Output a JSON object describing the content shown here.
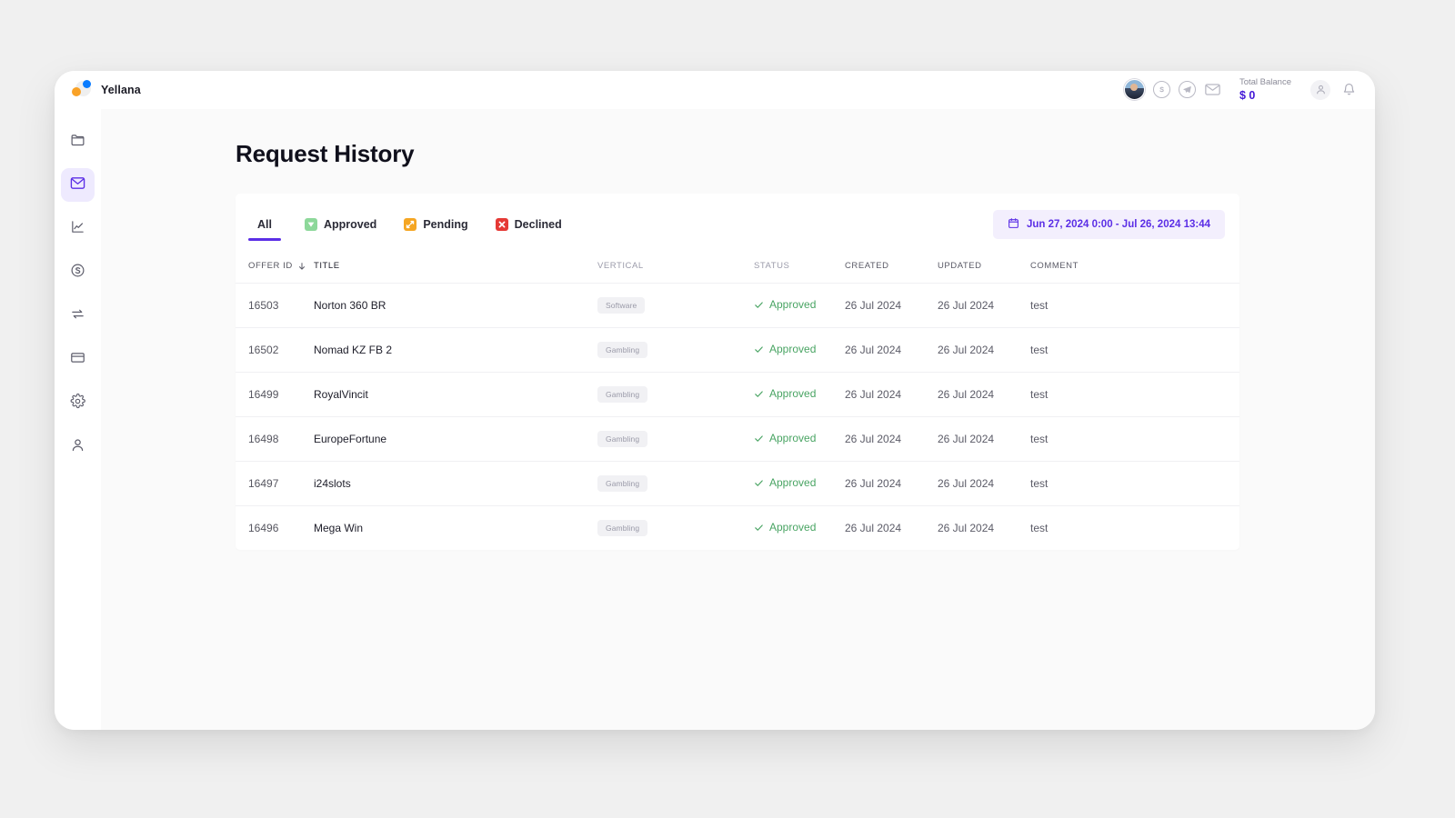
{
  "brand": {
    "name": "Yellana"
  },
  "topbar": {
    "avatar_name": "user-avatar",
    "icons": [
      "skype-icon",
      "telegram-icon",
      "mail-icon"
    ],
    "balance_label": "Total Balance",
    "balance_value": "$ 0",
    "account_icon": "user-circle-icon",
    "notification_icon": "bell-icon"
  },
  "sidebar": {
    "items": [
      {
        "name": "offers",
        "icon": "folder-icon",
        "active": false
      },
      {
        "name": "requests",
        "icon": "mail-icon",
        "active": true
      },
      {
        "name": "statistics",
        "icon": "chart-line-icon",
        "active": false
      },
      {
        "name": "finance",
        "icon": "dollar-circle-icon",
        "active": false
      },
      {
        "name": "conversions",
        "icon": "swap-arrows-icon",
        "active": false
      },
      {
        "name": "payments",
        "icon": "credit-card-icon",
        "active": false
      },
      {
        "name": "settings",
        "icon": "gear-icon",
        "active": false
      },
      {
        "name": "profile",
        "icon": "person-icon",
        "active": false
      }
    ]
  },
  "page": {
    "title": "Request History"
  },
  "tabs": [
    {
      "label": "All",
      "icon": null,
      "active": true
    },
    {
      "label": "Approved",
      "icon": "approved-green-icon",
      "active": false
    },
    {
      "label": "Pending",
      "icon": "pending-orange-icon",
      "active": false
    },
    {
      "label": "Declined",
      "icon": "declined-red-icon",
      "active": false
    }
  ],
  "date_range": {
    "icon": "calendar-icon",
    "text": "Jun 27, 2024 0:00 - Jul 26, 2024 13:44"
  },
  "table": {
    "columns": [
      {
        "key": "offer_id",
        "label": "OFFER ID",
        "sorted": true,
        "sort_dir": "desc"
      },
      {
        "key": "title",
        "label": "TITLE"
      },
      {
        "key": "vertical",
        "label": "VERTICAL"
      },
      {
        "key": "status",
        "label": "STATUS"
      },
      {
        "key": "created",
        "label": "CREATED"
      },
      {
        "key": "updated",
        "label": "UPDATED"
      },
      {
        "key": "comment",
        "label": "COMMENT"
      }
    ],
    "rows": [
      {
        "offer_id": "16503",
        "title": "Norton 360 BR",
        "vertical": "Software",
        "status": "Approved",
        "created": "26 Jul 2024",
        "updated": "26 Jul 2024",
        "comment": "test"
      },
      {
        "offer_id": "16502",
        "title": "Nomad KZ FB 2",
        "vertical": "Gambling",
        "status": "Approved",
        "created": "26 Jul 2024",
        "updated": "26 Jul 2024",
        "comment": "test"
      },
      {
        "offer_id": "16499",
        "title": "RoyalVincit",
        "vertical": "Gambling",
        "status": "Approved",
        "created": "26 Jul 2024",
        "updated": "26 Jul 2024",
        "comment": "test"
      },
      {
        "offer_id": "16498",
        "title": "EuropeFortune",
        "vertical": "Gambling",
        "status": "Approved",
        "created": "26 Jul 2024",
        "updated": "26 Jul 2024",
        "comment": "test"
      },
      {
        "offer_id": "16497",
        "title": "i24slots",
        "vertical": "Gambling",
        "status": "Approved",
        "created": "26 Jul 2024",
        "updated": "26 Jul 2024",
        "comment": "test"
      },
      {
        "offer_id": "16496",
        "title": "Mega Win",
        "vertical": "Gambling",
        "status": "Approved",
        "created": "26 Jul 2024",
        "updated": "26 Jul 2024",
        "comment": "test"
      }
    ]
  },
  "colors": {
    "accent": "#5b2ee6",
    "accent_soft": "#f3effd",
    "sidebar_active_bg": "#eeeafe",
    "approved_green": "#49a463",
    "pending_orange": "#f5a623",
    "declined_red": "#e53935",
    "page_bg": "#f0f0f0",
    "content_bg": "#fafafa",
    "brand_blue": "#0a7cff",
    "brand_orange": "#f9a227"
  }
}
